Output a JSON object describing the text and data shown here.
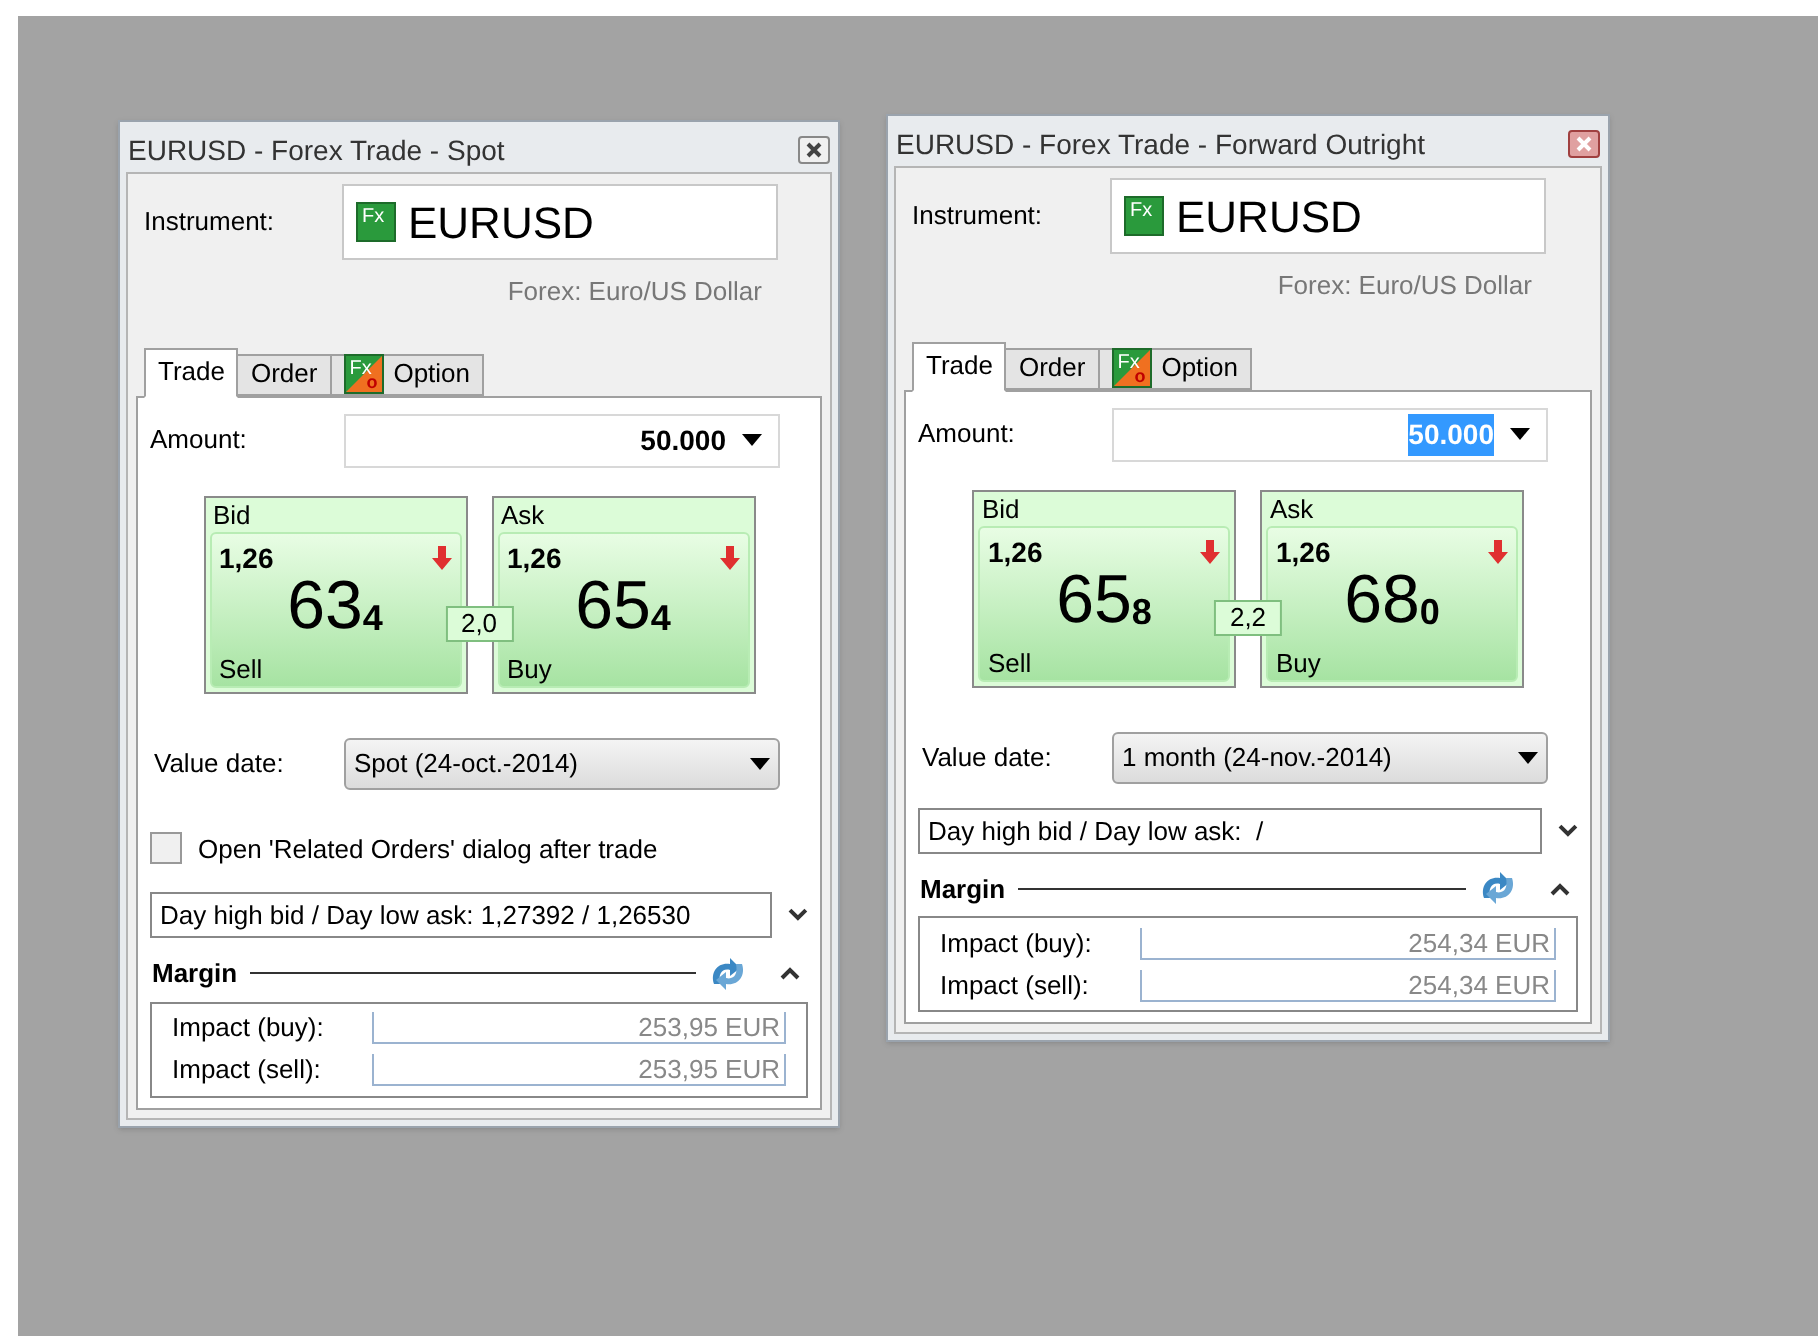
{
  "windows": [
    {
      "title": "EURUSD - Forex Trade - Spot",
      "active": false,
      "instrument_label": "Instrument:",
      "instrument": "EURUSD",
      "instrument_icon": "Fx",
      "description": "Forex: Euro/US Dollar",
      "tabs": [
        {
          "label": "Trade",
          "selected": true,
          "kind": "plain"
        },
        {
          "label": "Order",
          "selected": false,
          "kind": "plain"
        },
        {
          "label": "Option",
          "selected": false,
          "kind": "option",
          "icon": "Fx",
          "icon_sub": "o"
        }
      ],
      "amount_label": "Amount:",
      "amount": "50.000",
      "amount_selected": false,
      "quotes": [
        {
          "label": "Bid",
          "big": "1,26",
          "pips": "63",
          "fraction": "4",
          "action": "Sell"
        },
        {
          "label": "Ask",
          "big": "1,26",
          "pips": "65",
          "fraction": "4",
          "action": "Buy"
        }
      ],
      "spread": "2,0",
      "value_date_label": "Value date:",
      "value_date": "Spot (24-oct.-2014)",
      "checkbox": {
        "label": "Open 'Related Orders' dialog after trade",
        "checked": false
      },
      "day_range": "Day high bid / Day low ask: 1,27392 / 1,26530",
      "margin_title": "Margin",
      "margin_rows": [
        {
          "label": "Impact (buy):",
          "value": "253,95 EUR"
        },
        {
          "label": "Impact (sell):",
          "value": "253,95 EUR"
        }
      ]
    },
    {
      "title": "EURUSD - Forex Trade - Forward Outright",
      "active": true,
      "instrument_label": "Instrument:",
      "instrument": "EURUSD",
      "instrument_icon": "Fx",
      "description": "Forex: Euro/US Dollar",
      "tabs": [
        {
          "label": "Trade",
          "selected": true,
          "kind": "plain"
        },
        {
          "label": "Order",
          "selected": false,
          "kind": "plain"
        },
        {
          "label": "Option",
          "selected": false,
          "kind": "option",
          "icon": "Fx",
          "icon_sub": "o"
        }
      ],
      "amount_label": "Amount:",
      "amount": "50.000",
      "amount_selected": true,
      "quotes": [
        {
          "label": "Bid",
          "big": "1,26",
          "pips": "65",
          "fraction": "8",
          "action": "Sell"
        },
        {
          "label": "Ask",
          "big": "1,26",
          "pips": "68",
          "fraction": "0",
          "action": "Buy"
        }
      ],
      "spread": "2,2",
      "value_date_label": "Value date:",
      "value_date": "1 month (24-nov.-2014)",
      "day_range": "Day high bid / Day low ask:  /",
      "margin_title": "Margin",
      "margin_rows": [
        {
          "label": "Impact (buy):",
          "value": "254,34 EUR"
        },
        {
          "label": "Impact (sell):",
          "value": "254,34 EUR"
        }
      ]
    }
  ]
}
